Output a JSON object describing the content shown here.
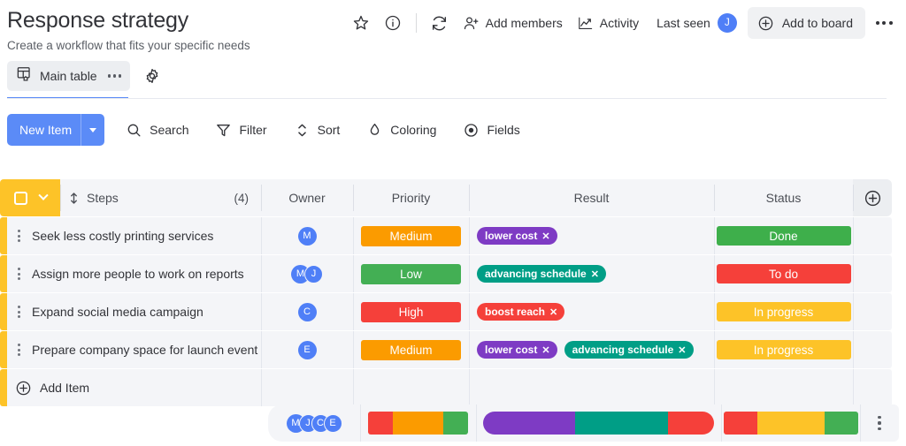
{
  "header": {
    "title": "Response strategy",
    "subtitle": "Create a workflow that fits your specific needs",
    "star_icon": "star-icon",
    "info_icon": "info-icon",
    "activity_log_icon": "refresh-history-icon",
    "add_members_label": "Add members",
    "activity_label": "Activity",
    "last_seen_label": "Last seen",
    "last_seen_avatar": "J",
    "add_to_board_label": "Add to board",
    "more_label": "•••"
  },
  "tabbar": {
    "tab_label": "Main table",
    "tab_icon": "board-table-icon",
    "tab_menu": "•••",
    "settings_icon": "gear-icon"
  },
  "toolbar": {
    "new_item_label": "New Item",
    "items": [
      {
        "label": "Search",
        "icon": "search-icon"
      },
      {
        "label": "Filter",
        "icon": "filter-icon"
      },
      {
        "label": "Sort",
        "icon": "sort-icon"
      },
      {
        "label": "Coloring",
        "icon": "coloring-drop-icon"
      },
      {
        "label": "Fields",
        "icon": "eye-fields-icon"
      }
    ]
  },
  "table": {
    "columns": {
      "steps": "Steps",
      "steps_count": "(4)",
      "owner": "Owner",
      "priority": "Priority",
      "result": "Result",
      "status": "Status"
    },
    "add_column_icon": "plus-circle-icon",
    "rows": [
      {
        "name": "Seek less costly printing services",
        "owners": [
          "M"
        ],
        "priority": {
          "label": "Medium",
          "color": "#fb9b00"
        },
        "result": [
          {
            "label": "lower cost",
            "color": "#7e3bc4"
          }
        ],
        "status": {
          "label": "Done",
          "color": "#3eaf4b"
        }
      },
      {
        "name": "Assign more people to work on reports",
        "owners": [
          "M",
          "J"
        ],
        "priority": {
          "label": "Low",
          "color": "#43af54"
        },
        "result": [
          {
            "label": "advancing schedule",
            "color": "#009e86"
          }
        ],
        "status": {
          "label": "To do",
          "color": "#f5403a"
        }
      },
      {
        "name": "Expand social media campaign",
        "owners": [
          "C"
        ],
        "priority": {
          "label": "High",
          "color": "#f5403a"
        },
        "result": [
          {
            "label": "boost reach",
            "color": "#f5403a"
          }
        ],
        "status": {
          "label": "In progress",
          "color": "#fdc328"
        }
      },
      {
        "name": "Prepare company space for launch event",
        "owners": [
          "E"
        ],
        "priority": {
          "label": "Medium",
          "color": "#fb9b00"
        },
        "result": [
          {
            "label": "lower cost",
            "color": "#7e3bc4"
          },
          {
            "label": "advancing schedule",
            "color": "#009e86"
          }
        ],
        "status": {
          "label": "In progress",
          "color": "#fdc328"
        }
      }
    ],
    "add_item_label": "Add Item",
    "add_item_icon": "plus-circle-icon"
  },
  "summary": {
    "owner_avatars": [
      "M",
      "J",
      "C",
      "E"
    ],
    "priority_bar": [
      {
        "color": "#f5403a",
        "pct": 25
      },
      {
        "color": "#fb9b00",
        "pct": 50
      },
      {
        "color": "#43af54",
        "pct": 25
      }
    ],
    "result_bar": [
      {
        "color": "#7e3bc4",
        "pct": 40
      },
      {
        "color": "#009e86",
        "pct": 40
      },
      {
        "color": "#f5403a",
        "pct": 20
      }
    ],
    "status_bar": [
      {
        "color": "#f5403a",
        "pct": 25
      },
      {
        "color": "#fdc328",
        "pct": 50
      },
      {
        "color": "#43af54",
        "pct": 25
      }
    ],
    "menu_icon": "kebab-menu-icon"
  },
  "colors": {
    "accent_blue": "#5b8bf7",
    "row_marker_yellow": "#fdc328",
    "cell_bg": "#f4f5f8"
  }
}
